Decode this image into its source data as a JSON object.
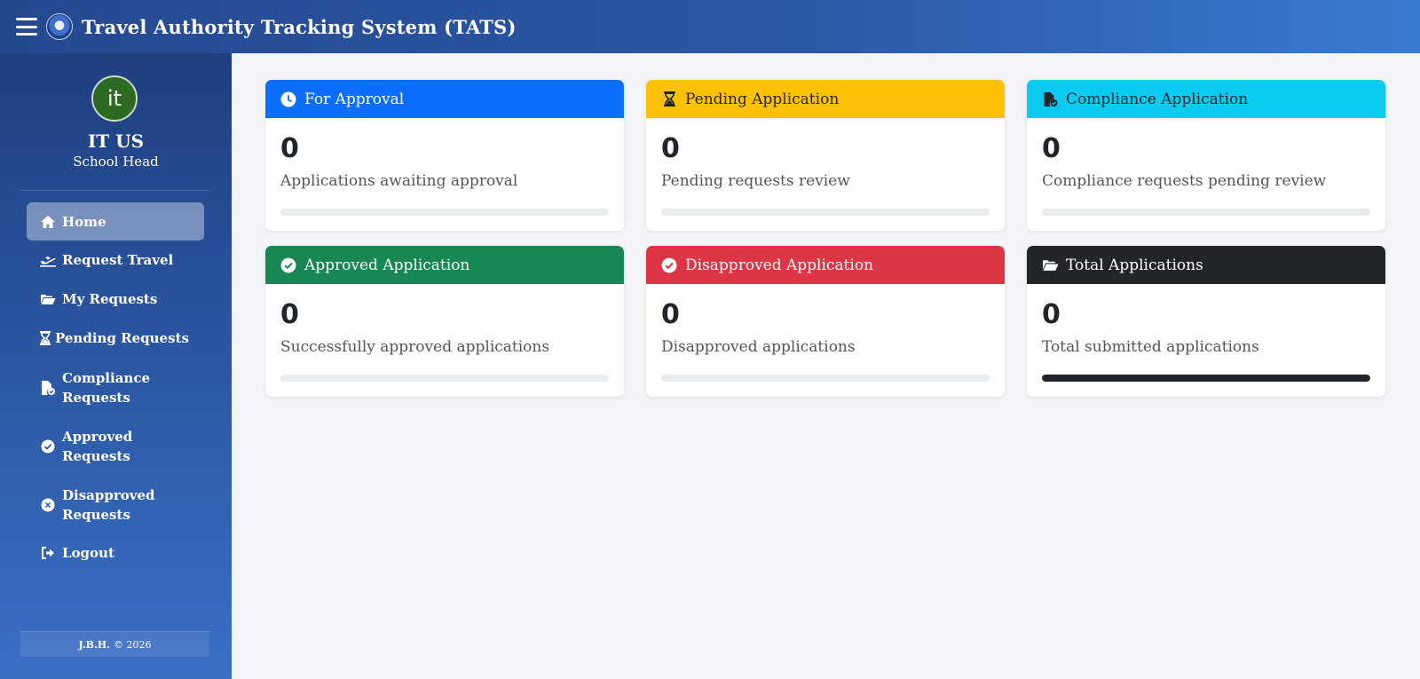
{
  "header": {
    "title": "Travel Authority Tracking System (TATS)",
    "menu_icon": "hamburger-icon",
    "logo": "seal-logo"
  },
  "user": {
    "initials": "it",
    "name": "IT US",
    "role": "School Head",
    "avatar_color": "#2e6b22"
  },
  "sidebar": {
    "items": [
      {
        "lines": [
          "Home"
        ],
        "icon": "home-icon",
        "active": true
      },
      {
        "lines": [
          "Request Travel"
        ],
        "icon": "plane-icon",
        "active": false
      },
      {
        "lines": [
          "My Requests"
        ],
        "icon": "folder-open-icon",
        "active": false
      },
      {
        "lines": [
          "Pending Requests"
        ],
        "icon": "hourglass-icon",
        "active": false
      },
      {
        "lines": [
          "Compliance",
          "Requests"
        ],
        "icon": "file-check-icon",
        "active": false
      },
      {
        "lines": [
          "Approved",
          "Requests"
        ],
        "icon": "check-circle-icon",
        "active": false
      },
      {
        "lines": [
          "Disapproved",
          "Requests"
        ],
        "icon": "x-circle-icon",
        "active": false
      },
      {
        "lines": [
          "Logout"
        ],
        "icon": "logout-icon",
        "active": false
      }
    ],
    "footer": {
      "author": "J.B.H.",
      "copyright": "© 2026"
    }
  },
  "cards": [
    {
      "title": "For Approval",
      "icon": "clock-icon",
      "color": "#0d6efd",
      "text_color": "#ffffff",
      "count": "0",
      "description": "Applications awaiting approval",
      "progress": 0
    },
    {
      "title": "Pending Application",
      "icon": "hourglass-icon",
      "color": "#ffc107",
      "text_color": "#212529",
      "count": "0",
      "description": "Pending requests review",
      "progress": 0
    },
    {
      "title": "Compliance Application",
      "icon": "file-check-icon",
      "color": "#0dcaf0",
      "text_color": "#212529",
      "count": "0",
      "description": "Compliance requests pending review",
      "progress": 0
    },
    {
      "title": "Approved Application",
      "icon": "check-circle-icon",
      "color": "#198754",
      "text_color": "#ffffff",
      "count": "0",
      "description": "Successfully approved applications",
      "progress": 0
    },
    {
      "title": "Disapproved Application",
      "icon": "check-circle-icon",
      "color": "#dc3545",
      "text_color": "#ffffff",
      "count": "0",
      "description": "Disapproved applications",
      "progress": 0
    },
    {
      "title": "Total Applications",
      "icon": "folder-open-icon",
      "color": "#212529",
      "text_color": "#ffffff",
      "count": "0",
      "description": "Total submitted applications",
      "progress": 100
    }
  ]
}
